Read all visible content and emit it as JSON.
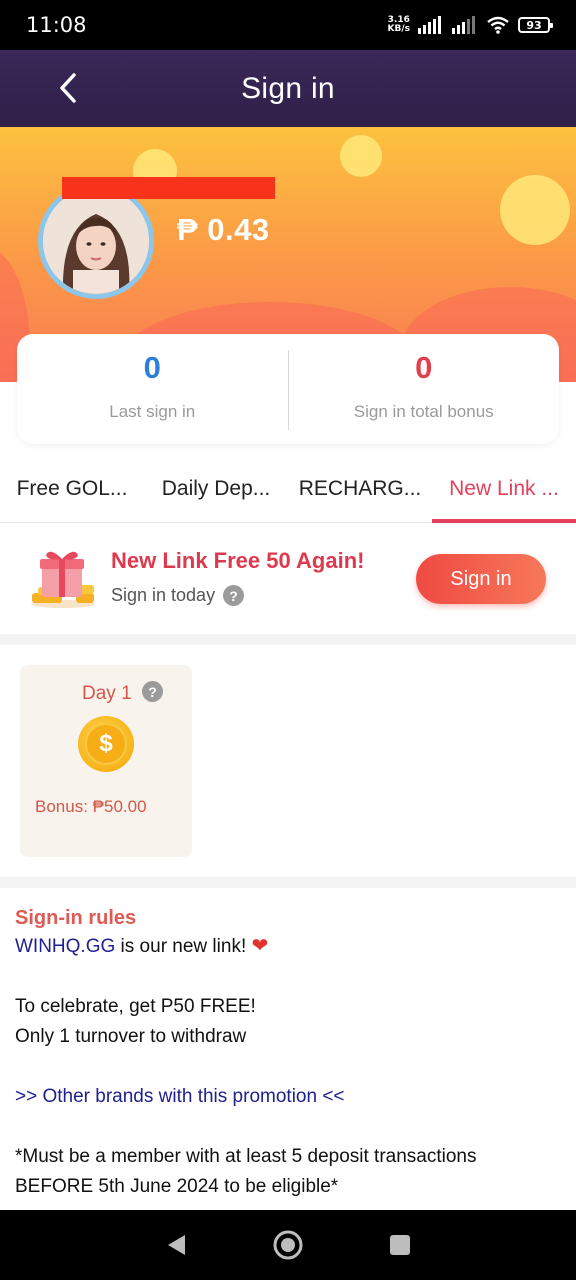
{
  "status_bar": {
    "time": "11:08",
    "net_speed_value": "3.16",
    "net_speed_unit": "KB/s",
    "battery": "93"
  },
  "header": {
    "title": "Sign in",
    "back_icon": "chevron-left-icon"
  },
  "profile": {
    "balance": "₱ 0.43",
    "avatar_icon": "user-avatar"
  },
  "stats": {
    "last_sign_in_value": "0",
    "last_sign_in_label": "Last sign in",
    "total_bonus_value": "0",
    "total_bonus_label": "Sign in total bonus",
    "colors": {
      "last_sign_in": "#2f7fd9",
      "total_bonus": "#e2404c"
    }
  },
  "tabs": [
    {
      "label": "Free GOL...",
      "active": false
    },
    {
      "label": "Daily Dep...",
      "active": false
    },
    {
      "label": "RECHARG...",
      "active": false
    },
    {
      "label": "New Link ...",
      "active": true
    }
  ],
  "today": {
    "title": "New Link Free 50 Again!",
    "subtitle": "Sign in today",
    "button_label": "Sign in",
    "gift_icon": "gift-icon"
  },
  "days": [
    {
      "label": "Day 1",
      "bonus": "Bonus: ₱50.00",
      "coin_symbol": "$"
    }
  ],
  "rules": {
    "title": "Sign-in rules",
    "link_text": "WINHQ.GG",
    "line1_rest": " is our new link! ",
    "heart": "❤",
    "line2": "To celebrate, get P50 FREE!",
    "line3": "Only 1 turnover to withdraw",
    "line4": ">> Other brands with this promotion <<",
    "line5": "*Must be a member with at least 5 deposit transactions",
    "line6": "BEFORE 5th June 2024 to be eligible*"
  },
  "nav": {
    "back_icon": "triangle-back-icon",
    "home_icon": "circle-home-icon",
    "recents_icon": "square-recents-icon"
  },
  "colors": {
    "accent": "#e2405d",
    "header_bg": "#3a2858",
    "hero_top": "#fcc23f",
    "hero_bottom": "#fa7b54"
  }
}
